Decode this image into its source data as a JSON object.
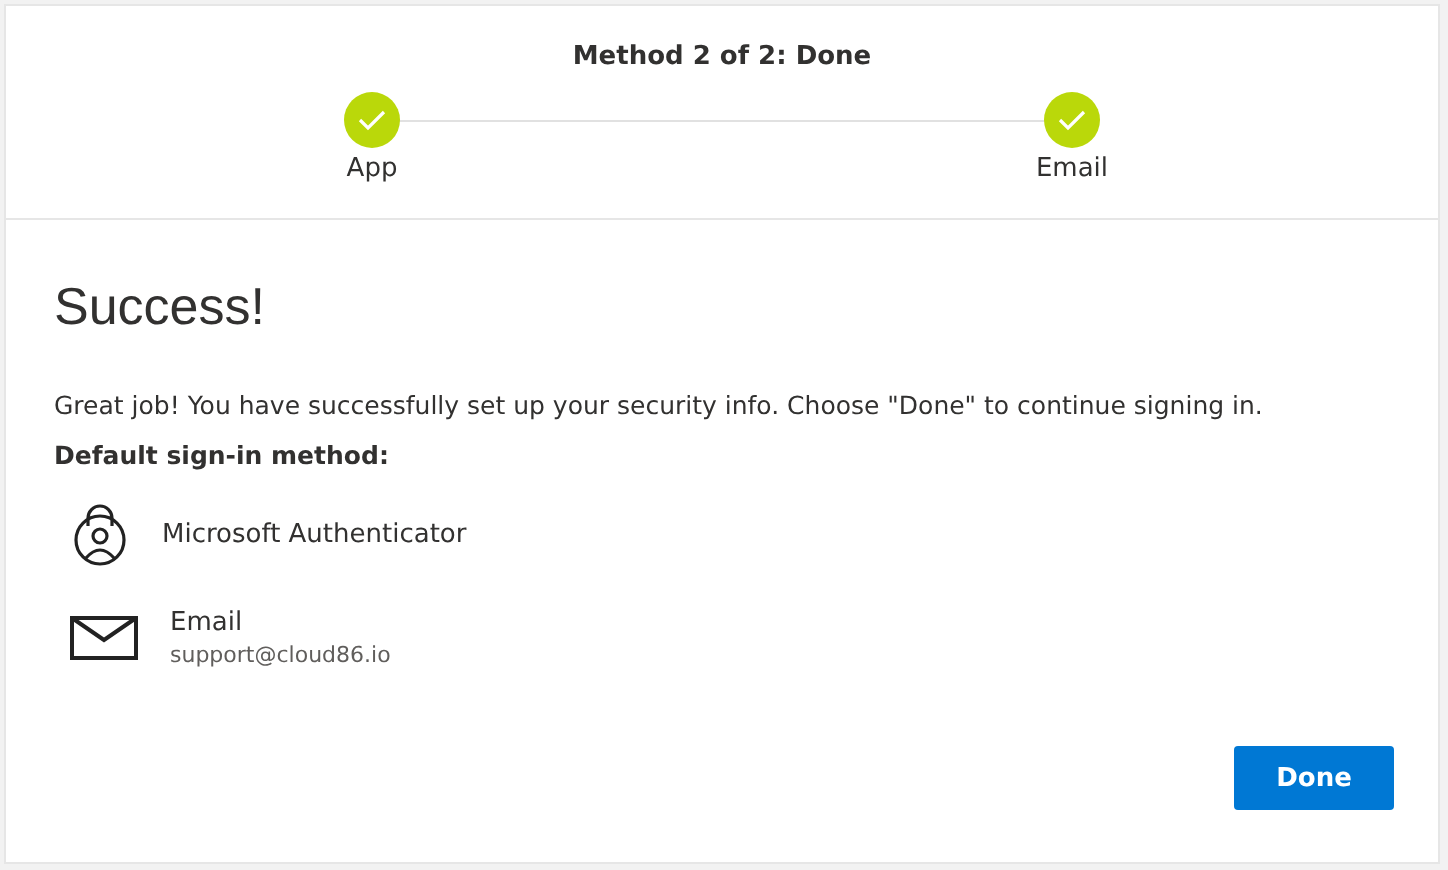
{
  "progress": {
    "title": "Method 2 of 2: Done",
    "steps": [
      {
        "label": "App",
        "done": true
      },
      {
        "label": "Email",
        "done": true
      }
    ]
  },
  "heading": "Success!",
  "message": "Great job! You have successfully set up your security info. Choose \"Done\" to continue signing in.",
  "default_label": "Default sign-in method:",
  "methods": [
    {
      "kind": "authenticator",
      "name": "Microsoft Authenticator"
    },
    {
      "kind": "email",
      "name": "Email",
      "detail": "support@cloud86.io"
    }
  ],
  "button": "Done"
}
